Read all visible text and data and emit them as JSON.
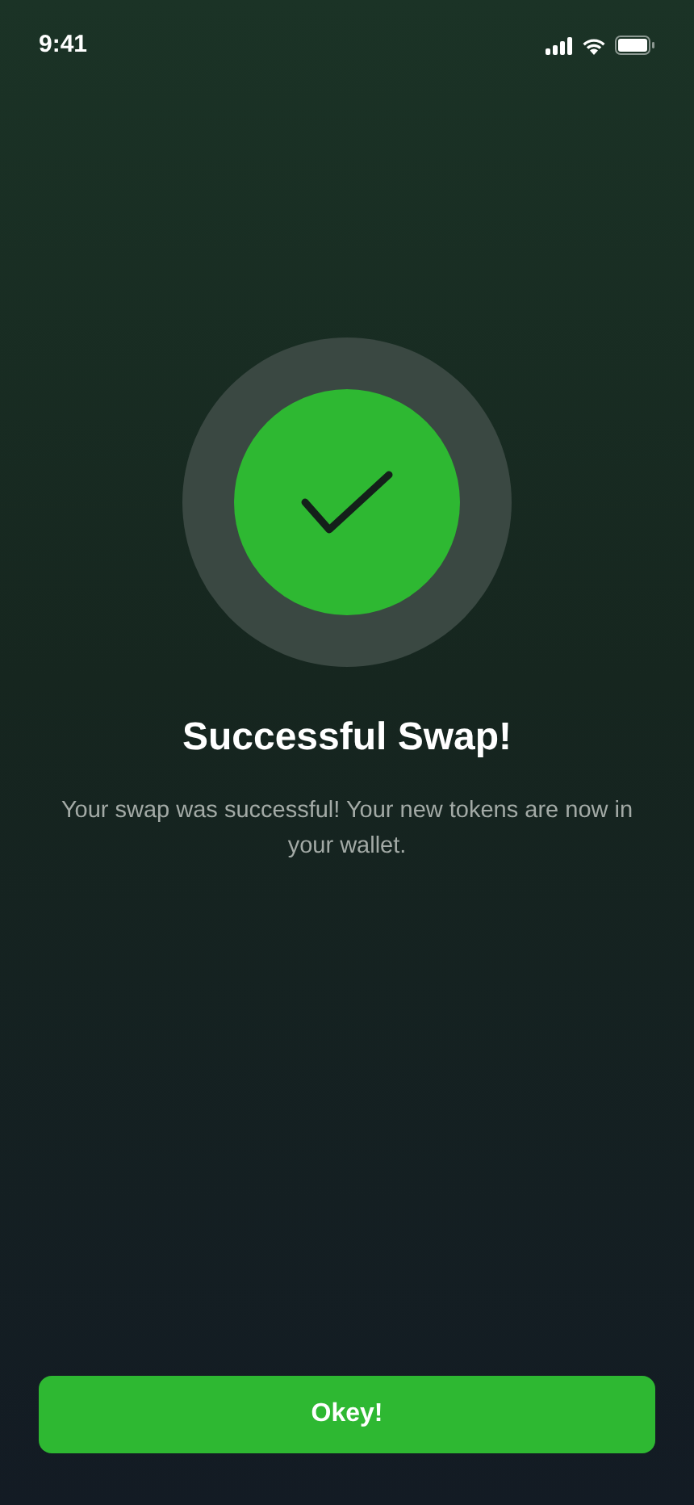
{
  "status_bar": {
    "time": "9:41"
  },
  "result": {
    "title": "Successful Swap!",
    "message": "Your swap was successful! Your new tokens are now in your wallet."
  },
  "button": {
    "label": "Okey!"
  }
}
